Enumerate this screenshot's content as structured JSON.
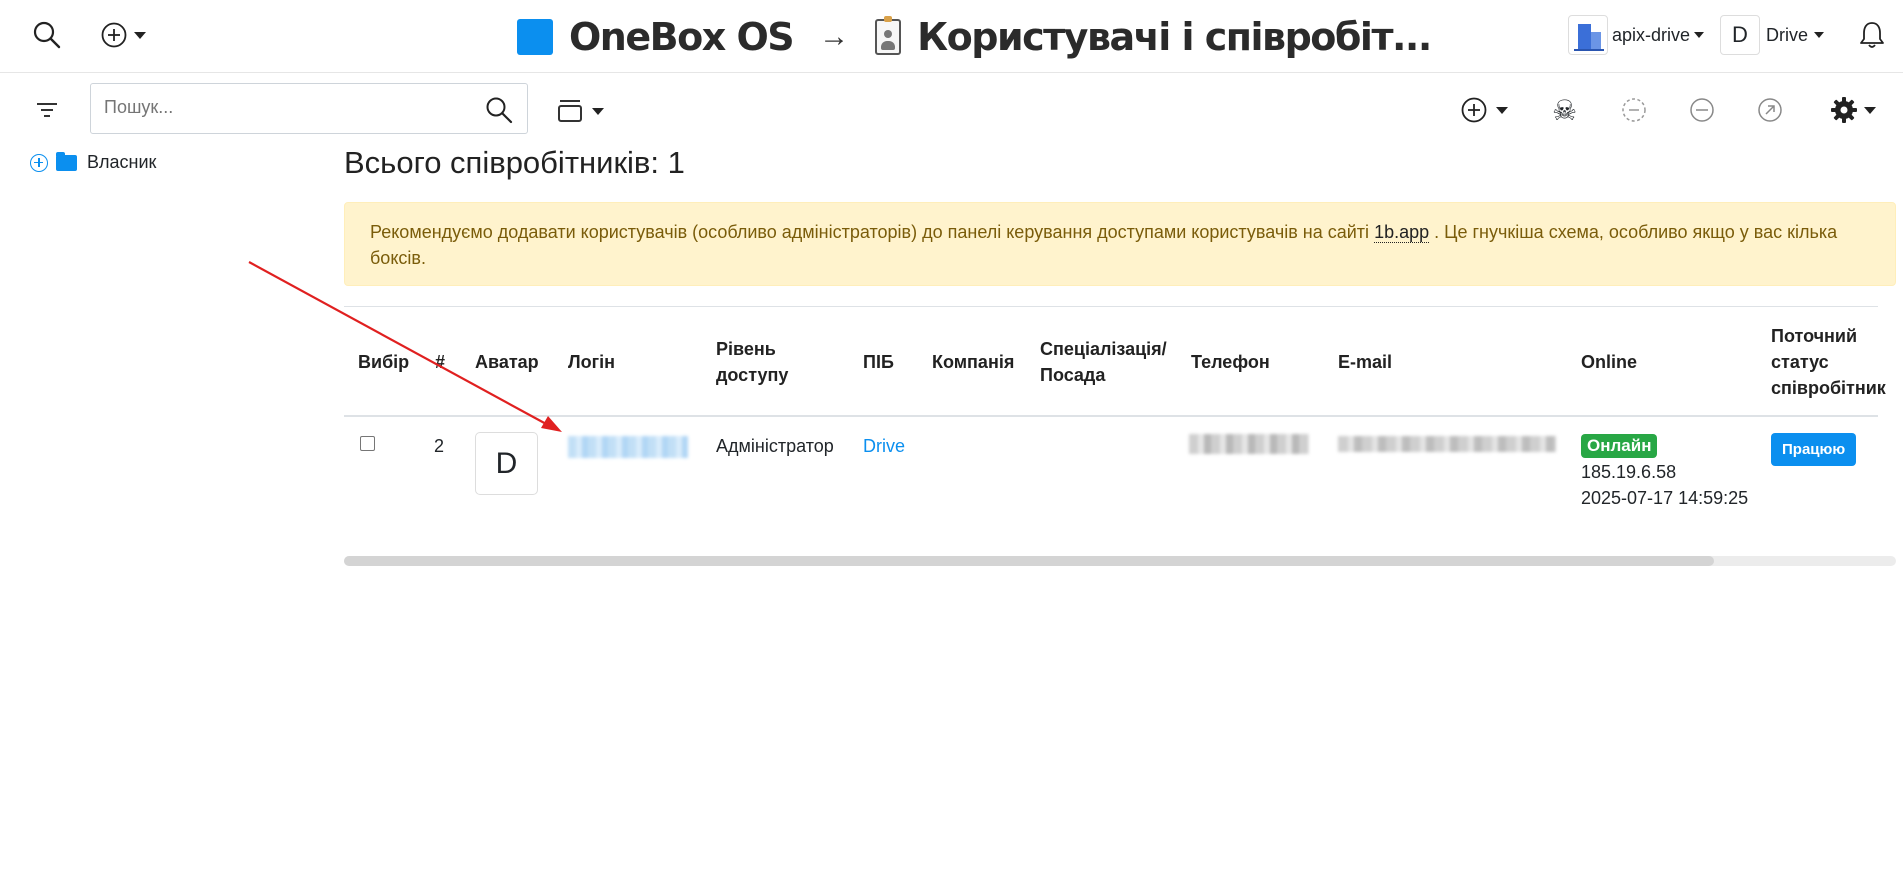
{
  "header": {
    "brand": "OneBox OS",
    "arrow": "→",
    "page_title": "Користувачі і співробіт...",
    "org_name": "apix-drive",
    "user_initial": "D",
    "user_name": "Drive"
  },
  "toolbar": {
    "search_placeholder": "Пошук...",
    "skull": "☠"
  },
  "sidebar": {
    "tree_item": "Власник"
  },
  "main": {
    "total": "Всього співробітників: 1",
    "alert_text": "Рекомендуємо додавати користувачів (особливо адміністраторів) до панелі керування доступами користувачів на сайті",
    "alert_link": "1b.app",
    "alert_text_after": ". Це гнучкіша схема, особливо якщо у вас кілька боксів."
  },
  "table": {
    "columns": {
      "select": "Вибір",
      "num": "#",
      "avatar": "Аватар",
      "login": "Логін",
      "access": "Рівень доступу",
      "pib": "ПІБ",
      "company": "Компанія",
      "position": "Спеціалізація/ Посада",
      "phone": "Телефон",
      "email": "E-mail",
      "online": "Online",
      "status": "Поточний статус співробітник"
    },
    "rows": [
      {
        "num": "2",
        "avatar_initial": "D",
        "access": "Адміністратор",
        "pib": "Drive",
        "online_badge": "Онлайн",
        "ip": "185.19.6.58",
        "datetime": "2025-07-17 14:59:25",
        "status_button": "Працюю"
      }
    ]
  },
  "colors": {
    "accent": "#0b8fef",
    "online": "#28a745",
    "alert_bg": "#fff3cd",
    "annotation_arrow": "#e02020"
  }
}
